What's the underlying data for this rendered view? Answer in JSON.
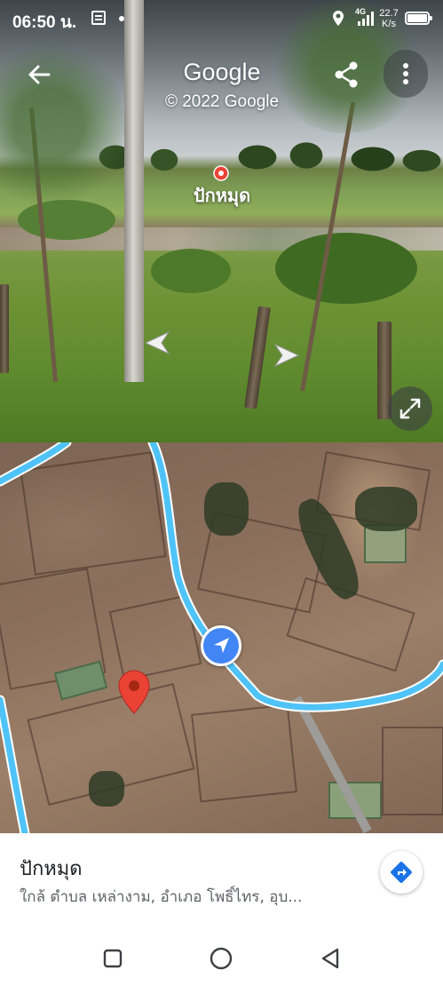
{
  "status_bar": {
    "time": "06:50 น.",
    "network": "4G",
    "speed_value": "22.7",
    "speed_unit": "K/s",
    "battery_level": 0.9
  },
  "street_view": {
    "title": "Google",
    "copyright": "© 2022 Google",
    "place_label": "ปักหมุด",
    "icons": [
      "back-arrow-icon",
      "share-icon",
      "more-vert-icon",
      "nav-chevron-left-icon",
      "nav-chevron-right-icon",
      "expand-icon"
    ]
  },
  "map": {
    "icons": [
      "navigation-arrow-icon",
      "map-pin-icon"
    ],
    "route_color": "#4fc3f7",
    "pin_color": "#ea4335"
  },
  "place_sheet": {
    "title": "ปักหมุด",
    "subtitle": "ใกล้ ตำบล เหล่างาม, อำเภอ โพธิ์ไทร, อุบ...",
    "icons": [
      "directions-icon"
    ],
    "accent": "#1a73e8"
  },
  "nav_bar": {
    "icons": [
      "recents-square-icon",
      "home-circle-icon",
      "back-triangle-icon"
    ]
  }
}
